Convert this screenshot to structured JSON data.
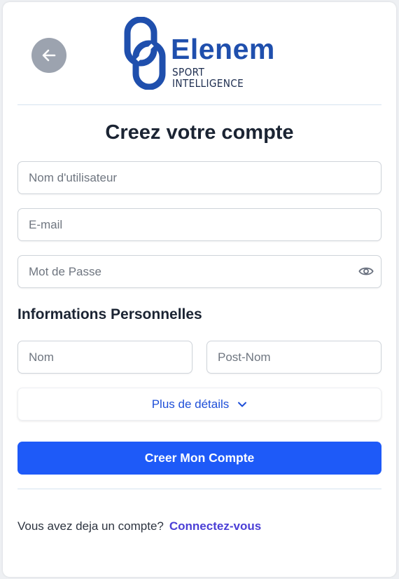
{
  "brand": {
    "name": "Elenem",
    "tagline": "SPORT INTELLIGENCE"
  },
  "form": {
    "title": "Creez votre compte",
    "username_placeholder": "Nom d'utilisateur",
    "email_placeholder": "E-mail",
    "password_placeholder": "Mot de Passe",
    "section_title": "Informations Personnelles",
    "first_name_placeholder": "Nom",
    "last_name_placeholder": "Post-Nom",
    "more_details_label": "Plus de détails",
    "submit_label": "Creer Mon Compte"
  },
  "footer": {
    "question": "Vous avez deja un compte?",
    "login_link": "Connectez-vous"
  },
  "icons": {
    "back": "arrow-left-icon",
    "logo": "chain-link-logo",
    "password_toggle": "eye-icon",
    "expand": "chevron-down-icon"
  },
  "colors": {
    "primary": "#1e5af8",
    "brand": "#1f4fad",
    "link": "#4b3fd6",
    "back_button": "#9ca3af"
  }
}
